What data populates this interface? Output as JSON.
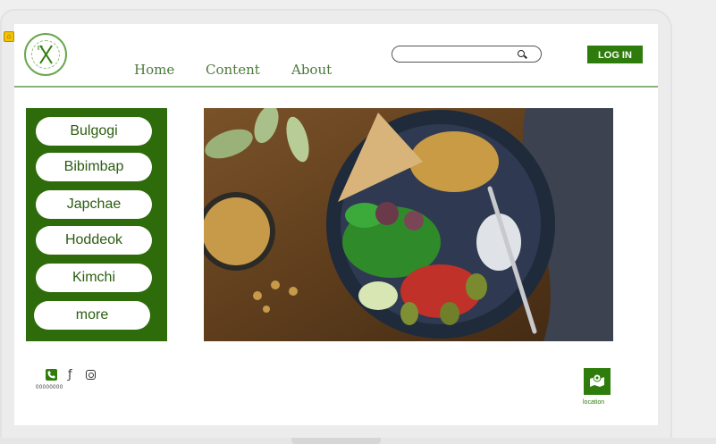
{
  "header": {
    "nav": [
      {
        "label": "Home"
      },
      {
        "label": "Content"
      },
      {
        "label": "About"
      }
    ],
    "search": {
      "placeholder": "",
      "value": ""
    },
    "login_label": "LOG IN"
  },
  "menu": {
    "items": [
      "Bulgogi",
      "Bibimbap",
      "Japchae",
      "Hoddeok",
      "Kimchi",
      "more"
    ]
  },
  "footer": {
    "phone_number": "00000000",
    "location_label": "location"
  },
  "colors": {
    "brand_green": "#2e7d0c",
    "menu_bg": "#2e6b0a",
    "nav_text": "#4c7a3a"
  },
  "icons": [
    "logo-fork-knife-icon",
    "search-icon",
    "phone-icon",
    "facebook-icon",
    "instagram-icon",
    "map-location-icon"
  ]
}
